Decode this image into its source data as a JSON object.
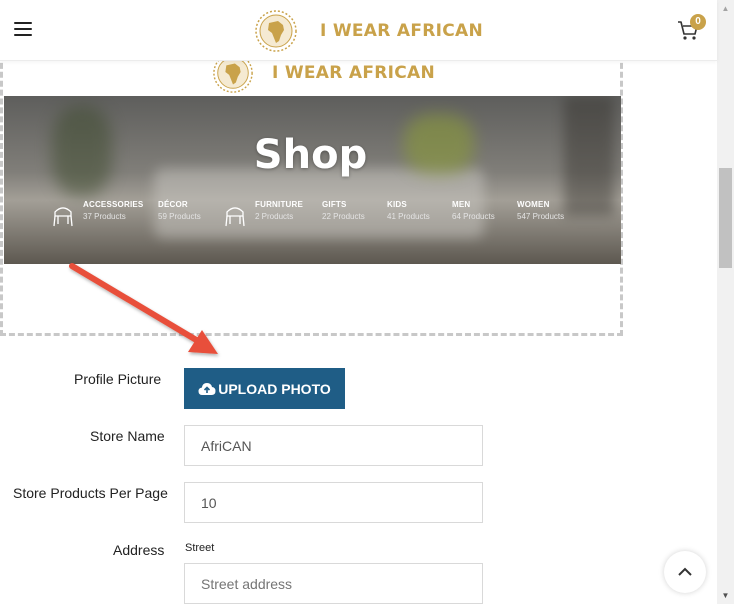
{
  "header": {
    "brand": "I WEAR AFRICAN",
    "cart_count": "0"
  },
  "preview": {
    "brand": "I WEAR AFRICAN",
    "banner_title": "Shop",
    "categories": [
      {
        "name": "ACCESSORIES",
        "count": "37 Products",
        "icon": "chair-icon"
      },
      {
        "name": "DÉCOR",
        "count": "59 Products",
        "icon": ""
      },
      {
        "name": "FURNITURE",
        "count": "2 Products",
        "icon": "chair-icon"
      },
      {
        "name": "GIFTS",
        "count": "22 Products",
        "icon": ""
      },
      {
        "name": "KIDS",
        "count": "41 Products",
        "icon": ""
      },
      {
        "name": "MEN",
        "count": "64 Products",
        "icon": ""
      },
      {
        "name": "WOMEN",
        "count": "547 Products",
        "icon": ""
      }
    ]
  },
  "form": {
    "profile_picture_label": "Profile Picture",
    "upload_button": "UPLOAD PHOTO",
    "store_name_label": "Store Name",
    "store_name_value": "AfriCAN",
    "per_page_label": "Store Products Per Page",
    "per_page_value": "10",
    "address_label": "Address",
    "street_label": "Street",
    "street_placeholder": "Street address"
  },
  "colors": {
    "brand_gold": "#c9a24a",
    "button_blue": "#1f5d86",
    "annotation_arrow": "#e8503a"
  },
  "icons": [
    "menu-icon",
    "cart-icon",
    "africa-logo-icon",
    "cloud-upload-icon",
    "chevron-up-icon",
    "chair-icon"
  ]
}
